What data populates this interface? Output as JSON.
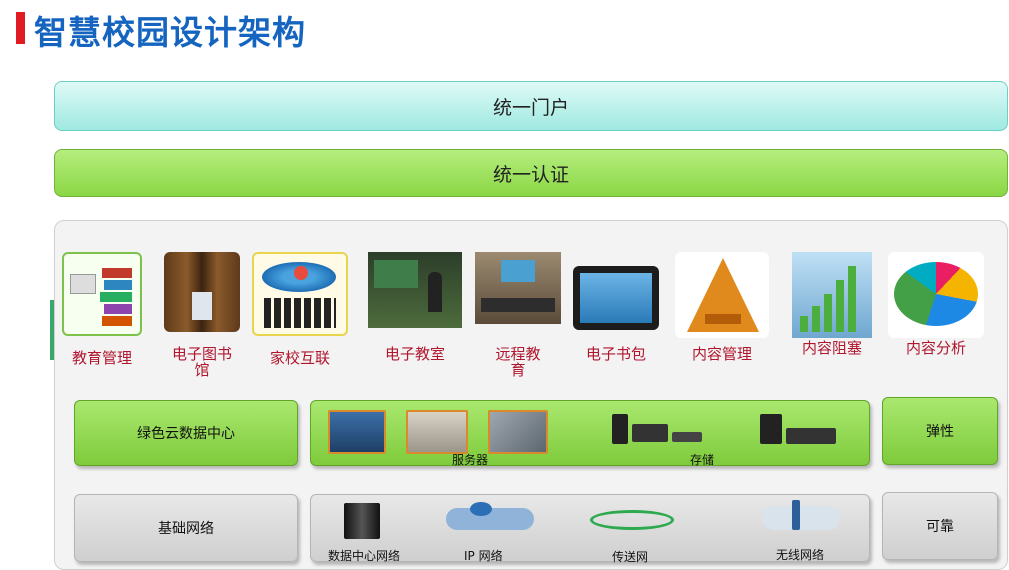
{
  "title": "智慧校园设计架构",
  "portal_label": "统一门户",
  "auth_label": "统一认证",
  "apps": [
    {
      "label": "教育管理",
      "icon": "books-icon"
    },
    {
      "label": "电子图书\n馆",
      "icon": "library-icon"
    },
    {
      "label": "家校互联",
      "icon": "people-network-icon"
    },
    {
      "label": "电子教室",
      "icon": "classroom-icon"
    },
    {
      "label": "远程教\n育",
      "icon": "remote-classroom-icon"
    },
    {
      "label": "电子书包",
      "icon": "tablet-icon"
    },
    {
      "label": "内容管理",
      "icon": "pyramid-icon"
    },
    {
      "label": "内容阻塞",
      "icon": "bar-growth-icon"
    },
    {
      "label": "内容分析",
      "icon": "pie-chart-icon"
    }
  ],
  "datacenter": {
    "label": "绿色云数据中心",
    "server_label": "服务器",
    "storage_label": "存储",
    "side_label": "弹性"
  },
  "network": {
    "label": "基础网络",
    "items": [
      "数据中心网络",
      "IP 网络",
      "传送网",
      "无线网络"
    ],
    "side_label": "可靠"
  },
  "colors": {
    "title": "#1565c0",
    "accent_bar": "#e01b24",
    "app_label": "#b0172e",
    "green": "#8ad645",
    "teal": "#9fe9e1"
  }
}
